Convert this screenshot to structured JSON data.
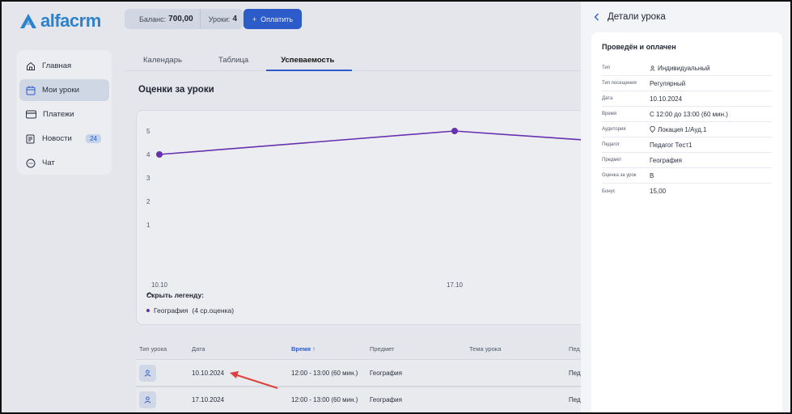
{
  "header": {
    "logo_text": "alfacrm",
    "balance_label": "Баланс:",
    "balance_value": "700,00",
    "lessons_label": "Уроки:",
    "lessons_value": "4",
    "pay_button": "Оплатить"
  },
  "sidebar": {
    "items": [
      {
        "label": "Главная",
        "icon": "home-icon"
      },
      {
        "label": "Мои уроки",
        "icon": "calendar-icon",
        "active": true
      },
      {
        "label": "Платежи",
        "icon": "card-icon"
      },
      {
        "label": "Новости",
        "icon": "news-icon",
        "badge": "24"
      },
      {
        "label": "Чат",
        "icon": "chat-icon"
      }
    ]
  },
  "main": {
    "tabs": [
      "Календарь",
      "Таблица",
      "Успеваемость"
    ],
    "active_tab": "Успеваемость",
    "section_title": "Оценки за уроки",
    "legend_toggle": "Скрыть легенду:",
    "legend_item": "География",
    "legend_item_note": "(4 ср.оценка)"
  },
  "chart_data": {
    "type": "line",
    "x": [
      "10.10",
      "17.10",
      ""
    ],
    "series": [
      {
        "name": "География",
        "values": [
          4,
          5,
          4.6
        ]
      }
    ],
    "y_ticks": [
      "5",
      "4",
      "3",
      "2",
      "1"
    ],
    "x_ticks": [
      "10.10",
      "17.10"
    ],
    "ylim": [
      0,
      5
    ],
    "color": "#6a32b8",
    "legend_position": "bottom-left"
  },
  "table": {
    "headers": {
      "type": "Тип урока",
      "date": "Дата",
      "time": "Время",
      "sort_indicator": "↑",
      "subject": "Предмет",
      "topic": "Тема урока",
      "teacher": "Пед"
    },
    "rows": [
      {
        "date": "10.10.2024",
        "time": "12:00 - 13:00 (60 мин.)",
        "subject": "География",
        "teacher": "Пед"
      },
      {
        "date": "17.10.2024",
        "time": "12:00 - 13:00 (60 мин.)",
        "subject": "География",
        "teacher": "Пед"
      }
    ]
  },
  "panel": {
    "title": "Детали урока",
    "card_title": "Проведён и оплачен",
    "rows": [
      {
        "label": "Тип",
        "value": "Индивидуальный",
        "icon": "person-icon"
      },
      {
        "label": "Тип посещения",
        "value": "Регулярный"
      },
      {
        "label": "Дата",
        "value": "10.10.2024"
      },
      {
        "label": "Время",
        "value": "С 12:00 до 13:00 (60 мин.)"
      },
      {
        "label": "Аудитория",
        "value": "Локация 1/Ауд.1",
        "icon": "location-icon"
      },
      {
        "label": "Педагог",
        "value": "Педагог Тест1"
      },
      {
        "label": "Предмет",
        "value": "География"
      },
      {
        "label": "Оценка за урок",
        "value": "В"
      },
      {
        "label": "Бонус",
        "value": "15,00"
      }
    ]
  },
  "colors": {
    "accent": "#2d5fd6",
    "logo": "#2c8ad8",
    "series": "#6a32b8",
    "annotation_arrow": "#e8453c"
  }
}
